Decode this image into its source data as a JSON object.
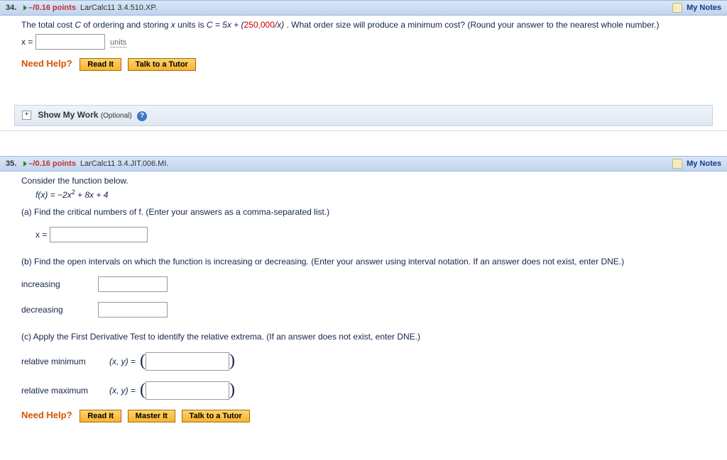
{
  "links": {
    "my_notes": "My Notes"
  },
  "buttons": {
    "read_it": "Read It",
    "talk_tutor": "Talk to a Tutor",
    "master_it": "Master It"
  },
  "need_help_label": "Need Help?",
  "show_work": {
    "label": "Show My Work",
    "optional": "(Optional)",
    "toggle": "+"
  },
  "q34": {
    "num": "34.",
    "points": "–/0.16 points",
    "source": "LarCalc11 3.4.510.XP.",
    "text_a": "The total cost ",
    "text_b": " of ordering and storing ",
    "text_c": " units is ",
    "equation_lhs": "C = 5x + (",
    "equation_red": "250,000",
    "equation_rhs": "/x)",
    "text_d": " . What order size will produce a minimum cost? (Round your answer to the nearest whole number.)",
    "x_equals": "x =",
    "units": "units"
  },
  "q35": {
    "num": "35.",
    "points": "–/0.16 points",
    "source": "LarCalc11 3.4.JIT.006.MI.",
    "intro": "Consider the function below.",
    "func": "f(x) = −2x",
    "func_sup": "2",
    "func_tail": " + 8x + 4",
    "part_a": "(a) Find the critical numbers of f. (Enter your answers as a comma-separated list.)",
    "x_equals": "x =",
    "part_b": "(b) Find the open intervals on which the function is increasing or decreasing. (Enter your answer using interval notation. If an answer does not exist, enter DNE.)",
    "increasing": "increasing",
    "decreasing": "decreasing",
    "part_c": "(c) Apply the First Derivative Test to identify the relative extrema. (If an answer does not exist, enter DNE.)",
    "rel_min": "relative minimum",
    "rel_max": "relative maximum",
    "xy_eq": "(x, y)  ="
  }
}
